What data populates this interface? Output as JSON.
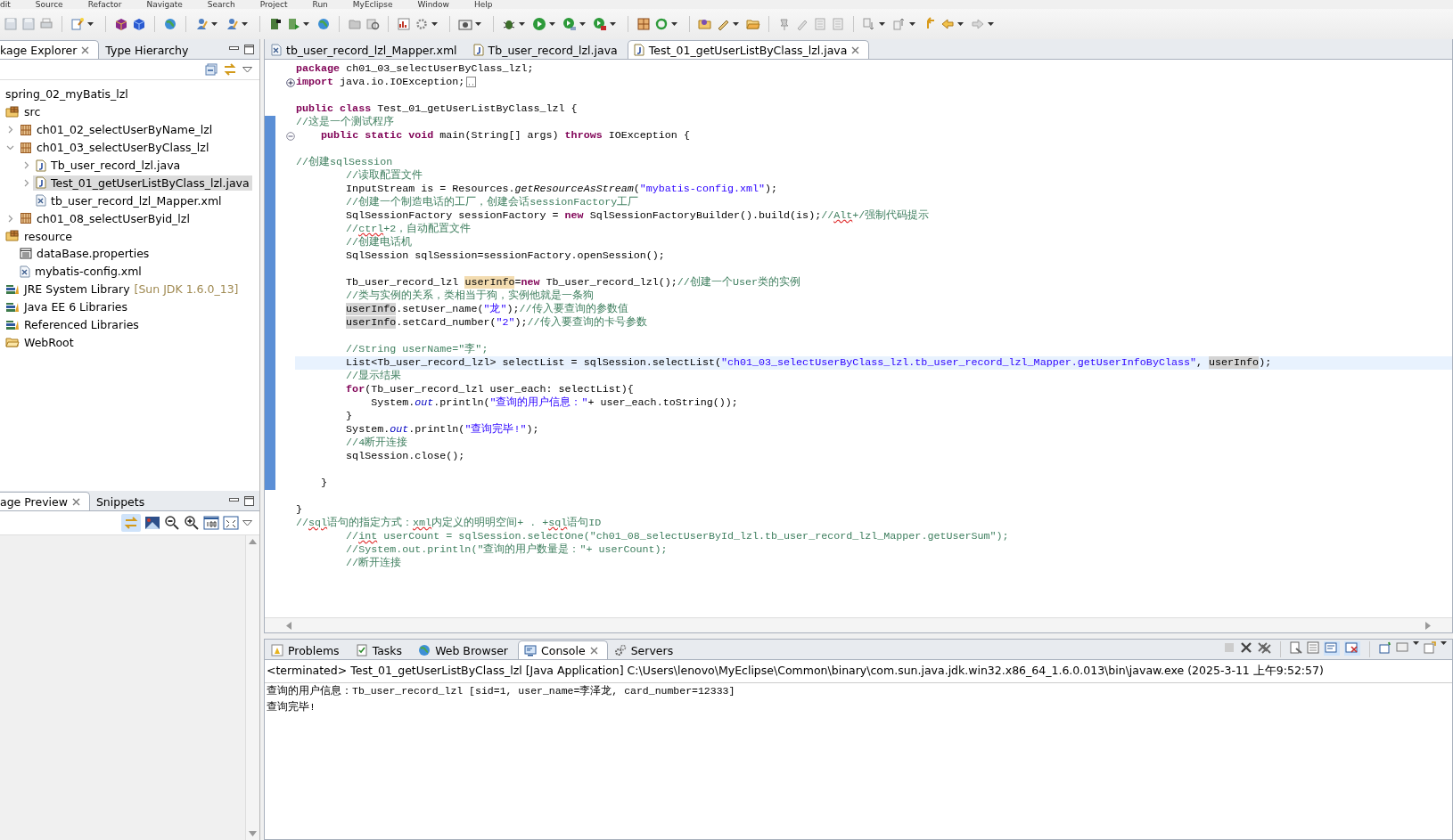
{
  "menu": [
    "dit",
    "Source",
    "Refactor",
    "Navigate",
    "Search",
    "Project",
    "Run",
    "MyEclipse",
    "Window",
    "Help"
  ],
  "explorer": {
    "tabs": [
      {
        "label": "kage Explorer",
        "selected": true
      },
      {
        "label": "Type Hierarchy",
        "selected": false
      }
    ],
    "tree": [
      {
        "label": "spring_02_myBatis_lzl",
        "children": [
          {
            "label": "src",
            "kind": "source-folder",
            "children": [
              {
                "label": "ch01_02_selectUserByName_lzl",
                "kind": "package",
                "expanded": false
              },
              {
                "label": "ch01_03_selectUserByClass_lzl",
                "kind": "package",
                "expanded": true,
                "children": [
                  {
                    "label": "Tb_user_record_lzl.java",
                    "kind": "java-file",
                    "expanded": false,
                    "selected": false
                  },
                  {
                    "label": "Test_01_getUserListByClass_lzl.java",
                    "kind": "java-file",
                    "expanded": false,
                    "selected": true
                  },
                  {
                    "label": "tb_user_record_lzl_Mapper.xml",
                    "kind": "xml-file",
                    "selected": false
                  }
                ]
              },
              {
                "label": "ch01_08_selectUserByid_lzl",
                "kind": "package",
                "expanded": false
              }
            ]
          },
          {
            "label": "resource",
            "kind": "source-folder",
            "children": [
              {
                "label": "dataBase.properties",
                "kind": "properties-file",
                "selected": false
              },
              {
                "label": "mybatis-config.xml",
                "kind": "xml-file",
                "selected": false
              }
            ]
          },
          {
            "label": "JRE System Library",
            "detail": "[Sun JDK 1.6.0_13]",
            "kind": "library"
          },
          {
            "label": "Java EE 6 Libraries",
            "kind": "library"
          },
          {
            "label": "Referenced Libraries",
            "kind": "library"
          },
          {
            "label": "WebRoot",
            "kind": "folder"
          }
        ]
      }
    ]
  },
  "preview": {
    "tabs": [
      {
        "label": "age Preview",
        "selected": true
      },
      {
        "label": "Snippets",
        "selected": false
      }
    ]
  },
  "editor": {
    "tabs": [
      {
        "label": "tb_user_record_lzl_Mapper.xml",
        "kind": "xml-file",
        "selected": false
      },
      {
        "label": "Tb_user_record_lzl.java",
        "kind": "java-file",
        "selected": false
      },
      {
        "label": "Test_01_getUserListByClass_lzl.java",
        "kind": "java-file",
        "selected": true
      }
    ],
    "lines": [
      {
        "current": false,
        "in_range": false,
        "segments": [
          {
            "kind": "keyword",
            "text": "package"
          },
          {
            "kind": "plain",
            "text": " ch01_03_selectUserByClass_lzl;"
          }
        ]
      },
      {
        "current": false,
        "in_range": false,
        "kind": "fold-collapsed",
        "segments": [
          {
            "kind": "keyword",
            "text": "import"
          },
          {
            "kind": "plain",
            "text": " java.io.IOException;"
          }
        ]
      },
      {
        "current": false,
        "in_range": false
      },
      {
        "current": false,
        "in_range": false,
        "segments": [
          {
            "kind": "keyword",
            "text": "public class"
          },
          {
            "kind": "plain",
            "text": " Test_01_getUserListByClass_lzl {"
          }
        ]
      },
      {
        "current": false,
        "in_range": true,
        "segments": [
          {
            "kind": "comment",
            "text": "//这是一个测试程序"
          }
        ]
      },
      {
        "current": false,
        "in_range": true,
        "kind": "fold-expanded",
        "segments": [
          {
            "kind": "keyword",
            "text": "    public static void"
          },
          {
            "kind": "plain",
            "text": " main(String[] args) "
          },
          {
            "kind": "keyword",
            "text": "throws"
          },
          {
            "kind": "plain",
            "text": " IOException {"
          }
        ]
      },
      {
        "current": false,
        "in_range": true
      },
      {
        "current": false,
        "in_range": true,
        "segments": [
          {
            "kind": "comment",
            "text": "//创建sqlSession"
          }
        ]
      },
      {
        "current": false,
        "in_range": true,
        "segments": [
          {
            "kind": "comment",
            "text": "        //读取配置文件"
          }
        ]
      },
      {
        "current": false,
        "in_range": true,
        "segments": [
          {
            "kind": "plain",
            "text": "        InputStream is = Resources."
          },
          {
            "kind": "static",
            "text": "getResourceAsStream"
          },
          {
            "kind": "plain",
            "text": "("
          },
          {
            "kind": "string",
            "text": "\"mybatis-config.xml\""
          },
          {
            "kind": "plain",
            "text": ");"
          }
        ]
      },
      {
        "current": false,
        "in_range": true,
        "segments": [
          {
            "kind": "comment",
            "text": "        //创建一个制造电话的工厂，创建会话sessionFactory工厂"
          }
        ]
      },
      {
        "current": false,
        "in_range": true,
        "segments": [
          {
            "kind": "plain",
            "text": "        SqlSessionFactory sessionFactory = "
          },
          {
            "kind": "keyword",
            "text": "new"
          },
          {
            "kind": "plain",
            "text": " SqlSessionFactoryBuilder().build(is);"
          },
          {
            "kind": "comment",
            "text": "//"
          },
          {
            "kind": "typo",
            "text": "Alt"
          },
          {
            "kind": "comment",
            "text": "+/强制代码提示"
          }
        ]
      },
      {
        "current": false,
        "in_range": true,
        "segments": [
          {
            "kind": "comment",
            "text": "        //"
          },
          {
            "kind": "typo",
            "text": "ctrl"
          },
          {
            "kind": "comment",
            "text": "+2，自动配置文件"
          }
        ]
      },
      {
        "current": false,
        "in_range": true,
        "segments": [
          {
            "kind": "comment",
            "text": "        //创建电话机"
          }
        ]
      },
      {
        "current": false,
        "in_range": true,
        "segments": [
          {
            "kind": "plain",
            "text": "        SqlSession sqlSession=sessionFactory.openSession();"
          }
        ]
      },
      {
        "current": false,
        "in_range": true
      },
      {
        "current": false,
        "in_range": true,
        "segments": [
          {
            "kind": "plain",
            "text": "        Tb_user_record_lzl "
          },
          {
            "kind": "write",
            "text": "userInfo"
          },
          {
            "kind": "plain",
            "text": "="
          },
          {
            "kind": "keyword",
            "text": "new"
          },
          {
            "kind": "plain",
            "text": " Tb_user_record_lzl();"
          },
          {
            "kind": "comment",
            "text": "//创建一个User类的实例"
          }
        ]
      },
      {
        "current": false,
        "in_range": true,
        "segments": [
          {
            "kind": "comment",
            "text": "        //类与实例的关系，类相当于狗，实例他就是一条狗"
          }
        ]
      },
      {
        "current": false,
        "in_range": true,
        "segments": [
          {
            "kind": "read",
            "text": "        userInfo"
          },
          {
            "kind": "plain",
            "text": ".setUser_name("
          },
          {
            "kind": "string",
            "text": "\"龙\""
          },
          {
            "kind": "plain",
            "text": ");"
          },
          {
            "kind": "comment",
            "text": "//传入要查询的参数值"
          }
        ]
      },
      {
        "current": false,
        "in_range": true,
        "segments": [
          {
            "kind": "read",
            "text": "        userInfo"
          },
          {
            "kind": "plain",
            "text": ".setCard_number("
          },
          {
            "kind": "string",
            "text": "\"2\""
          },
          {
            "kind": "plain",
            "text": ");"
          },
          {
            "kind": "comment",
            "text": "//传入要查询的卡号参数"
          }
        ]
      },
      {
        "current": false,
        "in_range": true
      },
      {
        "current": false,
        "in_range": true,
        "segments": [
          {
            "kind": "comment",
            "text": "        //String userName=\"李\";"
          }
        ]
      },
      {
        "current": true,
        "in_range": true,
        "segments": [
          {
            "kind": "plain",
            "text": "        List<Tb_user_record_lzl> selectList = sqlSession.selectList("
          },
          {
            "kind": "string",
            "text": "\"ch01_03_selectUserByClass_lzl.tb_user_record_lzl_Mapper.getUserInfoByClass\""
          },
          {
            "kind": "plain",
            "text": ", "
          },
          {
            "kind": "read",
            "text": "userInfo"
          },
          {
            "kind": "plain",
            "text": ");"
          }
        ]
      },
      {
        "current": false,
        "in_range": true,
        "segments": [
          {
            "kind": "comment",
            "text": "        //显示结果"
          }
        ]
      },
      {
        "current": false,
        "in_range": true,
        "segments": [
          {
            "kind": "keyword",
            "text": "        for"
          },
          {
            "kind": "plain",
            "text": "(Tb_user_record_lzl user_each: selectList){"
          }
        ]
      },
      {
        "current": false,
        "in_range": true,
        "segments": [
          {
            "kind": "plain",
            "text": "            System."
          },
          {
            "kind": "field",
            "text": "out"
          },
          {
            "kind": "plain",
            "text": ".println("
          },
          {
            "kind": "string",
            "text": "\"查询的用户信息：\""
          },
          {
            "kind": "plain",
            "text": "+ user_each.toString());"
          }
        ]
      },
      {
        "current": false,
        "in_range": true,
        "segments": [
          {
            "kind": "plain",
            "text": "        }"
          }
        ]
      },
      {
        "current": false,
        "in_range": true,
        "segments": [
          {
            "kind": "plain",
            "text": "        System."
          },
          {
            "kind": "field",
            "text": "out"
          },
          {
            "kind": "plain",
            "text": ".println("
          },
          {
            "kind": "string",
            "text": "\"查询完毕!\""
          },
          {
            "kind": "plain",
            "text": ");"
          }
        ]
      },
      {
        "current": false,
        "in_range": true,
        "segments": [
          {
            "kind": "comment",
            "text": "        //4断开连接"
          }
        ]
      },
      {
        "current": false,
        "in_range": true,
        "segments": [
          {
            "kind": "plain",
            "text": "        sqlSession.close();"
          }
        ]
      },
      {
        "current": false,
        "in_range": true
      },
      {
        "current": false,
        "in_range": true,
        "segments": [
          {
            "kind": "plain",
            "text": "    }"
          }
        ]
      },
      {
        "current": false,
        "in_range": false
      },
      {
        "current": false,
        "in_range": false,
        "segments": [
          {
            "kind": "plain",
            "text": "}"
          }
        ]
      },
      {
        "current": false,
        "in_range": false,
        "segments": [
          {
            "kind": "comment",
            "text": "//"
          },
          {
            "kind": "typo",
            "text": "sql"
          },
          {
            "kind": "comment",
            "text": "语句的指定方式："
          },
          {
            "kind": "typo",
            "text": "xml"
          },
          {
            "kind": "comment",
            "text": "内定义的明明空间+ . +"
          },
          {
            "kind": "typo",
            "text": "sql"
          },
          {
            "kind": "comment",
            "text": "语句ID"
          }
        ]
      },
      {
        "current": false,
        "in_range": false,
        "segments": [
          {
            "kind": "comment",
            "text": "        //"
          },
          {
            "kind": "typo",
            "text": "int"
          },
          {
            "kind": "comment",
            "text": " userCount = sqlSession.selectOne(\"ch01_08_selectUserById_lzl.tb_user_record_lzl_Mapper.getUserSum\");"
          }
        ]
      },
      {
        "current": false,
        "in_range": false,
        "segments": [
          {
            "kind": "comment",
            "text": "        //System.out.println(\"查询的用户数量是：\"+ userCount);"
          }
        ]
      },
      {
        "current": false,
        "in_range": false,
        "segments": [
          {
            "kind": "comment",
            "text": "        //断开连接"
          }
        ]
      }
    ]
  },
  "bottom": {
    "tabs": [
      {
        "label": "Problems",
        "kind": "problems",
        "selected": false
      },
      {
        "label": "Tasks",
        "kind": "tasks",
        "selected": false
      },
      {
        "label": "Web Browser",
        "kind": "globe",
        "selected": false
      },
      {
        "label": "Console",
        "kind": "console",
        "selected": true
      },
      {
        "label": "Servers",
        "kind": "servers",
        "selected": false
      }
    ],
    "console": {
      "header": "<terminated> Test_01_getUserListByClass_lzl [Java Application] C:\\Users\\lenovo\\MyEclipse\\Common\\binary\\com.sun.java.jdk.win32.x86_64_1.6.0.013\\bin\\javaw.exe (2025-3-11 上午9:52:57)",
      "output": [
        "查询的用户信息：Tb_user_record_lzl [sid=1, user_name=李泽龙, card_number=12333]",
        "查询完毕!"
      ]
    }
  }
}
